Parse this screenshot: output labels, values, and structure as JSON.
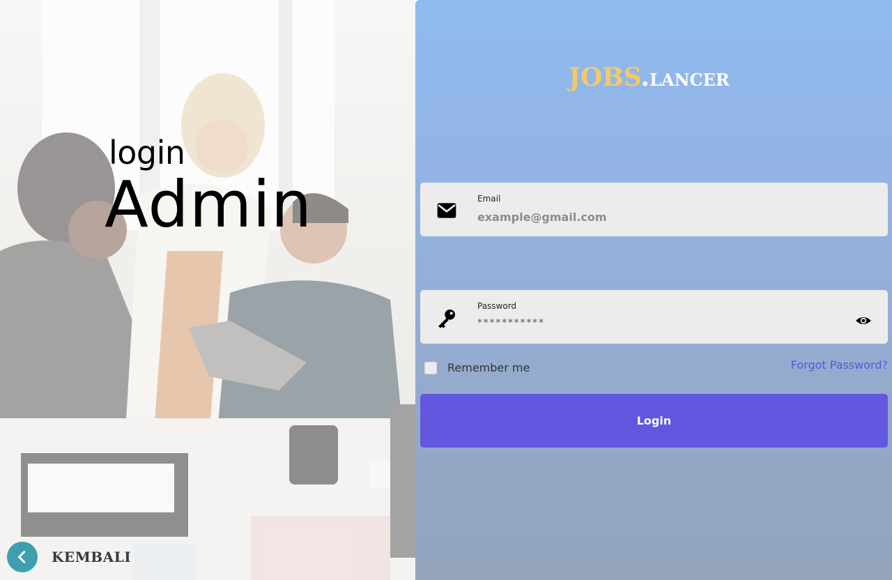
{
  "hero": {
    "heading_small": "login",
    "heading_large": "Admin"
  },
  "back": {
    "label": "KEMBALI",
    "icon": "chevron-left-icon"
  },
  "brand": {
    "part1": "JOBS",
    "dot": ".",
    "part2": "LANCER"
  },
  "form": {
    "email": {
      "label": "Email",
      "placeholder": "example@gmail.com",
      "value": "",
      "icon": "mail-icon"
    },
    "password": {
      "label": "Password",
      "value": "***********",
      "icon": "key-icon",
      "toggle_icon": "eye-icon"
    },
    "remember_label": "Remember me",
    "remember_checked": false,
    "forgot_label": "Forgot Password?",
    "submit_label": "Login"
  },
  "colors": {
    "brand_gold": "#f2c96b",
    "accent_purple": "#6257de",
    "link_purple": "#5b55de",
    "back_teal": "#3f9fae"
  }
}
